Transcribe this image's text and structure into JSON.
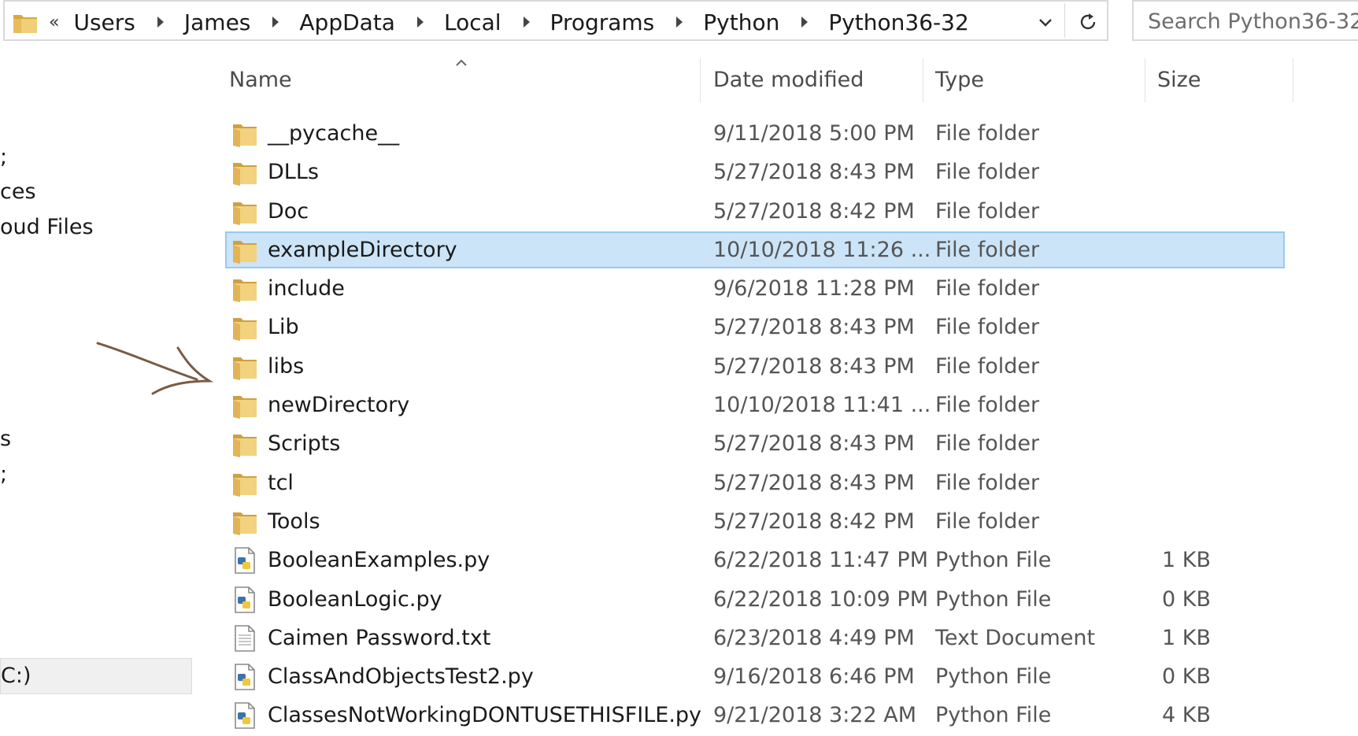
{
  "address": {
    "overflow_label": "«",
    "breadcrumbs": [
      "Users",
      "James",
      "AppData",
      "Local",
      "Programs",
      "Python",
      "Python36-32"
    ]
  },
  "search": {
    "placeholder": "Search Python36-32"
  },
  "nav": {
    "items": [
      ";",
      "ces",
      "oud Files",
      "s",
      ";",
      "C:)"
    ]
  },
  "columns": {
    "name": "Name",
    "date": "Date modified",
    "type": "Type",
    "size": "Size"
  },
  "files": [
    {
      "name": "__pycache__",
      "date": "9/11/2018 5:00 PM",
      "type": "File folder",
      "size": "",
      "icon": "folder-icon"
    },
    {
      "name": "DLLs",
      "date": "5/27/2018 8:43 PM",
      "type": "File folder",
      "size": "",
      "icon": "folder-icon"
    },
    {
      "name": "Doc",
      "date": "5/27/2018 8:42 PM",
      "type": "File folder",
      "size": "",
      "icon": "folder-icon"
    },
    {
      "name": "exampleDirectory",
      "date": "10/10/2018 11:26 ...",
      "type": "File folder",
      "size": "",
      "icon": "folder-icon",
      "selected": true
    },
    {
      "name": "include",
      "date": "9/6/2018 11:28 PM",
      "type": "File folder",
      "size": "",
      "icon": "folder-icon"
    },
    {
      "name": "Lib",
      "date": "5/27/2018 8:43 PM",
      "type": "File folder",
      "size": "",
      "icon": "folder-icon"
    },
    {
      "name": "libs",
      "date": "5/27/2018 8:43 PM",
      "type": "File folder",
      "size": "",
      "icon": "folder-icon"
    },
    {
      "name": "newDirectory",
      "date": "10/10/2018 11:41 ...",
      "type": "File folder",
      "size": "",
      "icon": "folder-icon"
    },
    {
      "name": "Scripts",
      "date": "5/27/2018 8:43 PM",
      "type": "File folder",
      "size": "",
      "icon": "folder-icon"
    },
    {
      "name": "tcl",
      "date": "5/27/2018 8:43 PM",
      "type": "File folder",
      "size": "",
      "icon": "folder-icon"
    },
    {
      "name": "Tools",
      "date": "5/27/2018 8:42 PM",
      "type": "File folder",
      "size": "",
      "icon": "folder-icon"
    },
    {
      "name": "BooleanExamples.py",
      "date": "6/22/2018 11:47 PM",
      "type": "Python File",
      "size": "1 KB",
      "icon": "python-file-icon"
    },
    {
      "name": "BooleanLogic.py",
      "date": "6/22/2018 10:09 PM",
      "type": "Python File",
      "size": "0 KB",
      "icon": "python-file-icon"
    },
    {
      "name": "Caimen Password.txt",
      "date": "6/23/2018 4:49 PM",
      "type": "Text Document",
      "size": "1 KB",
      "icon": "text-file-icon"
    },
    {
      "name": "ClassAndObjectsTest2.py",
      "date": "9/16/2018 6:46 PM",
      "type": "Python File",
      "size": "0 KB",
      "icon": "python-file-icon"
    },
    {
      "name": "ClassesNotWorkingDONTUSETHISFILE.py",
      "date": "9/21/2018 3:22 AM",
      "type": "Python File",
      "size": "4 KB",
      "icon": "python-file-icon"
    }
  ],
  "colors": {
    "selection_bg": "#cce4f7",
    "selection_border": "#99c9ef",
    "folder_yellow": "#e8c472",
    "annotation_arrow": "#7a5c43"
  }
}
